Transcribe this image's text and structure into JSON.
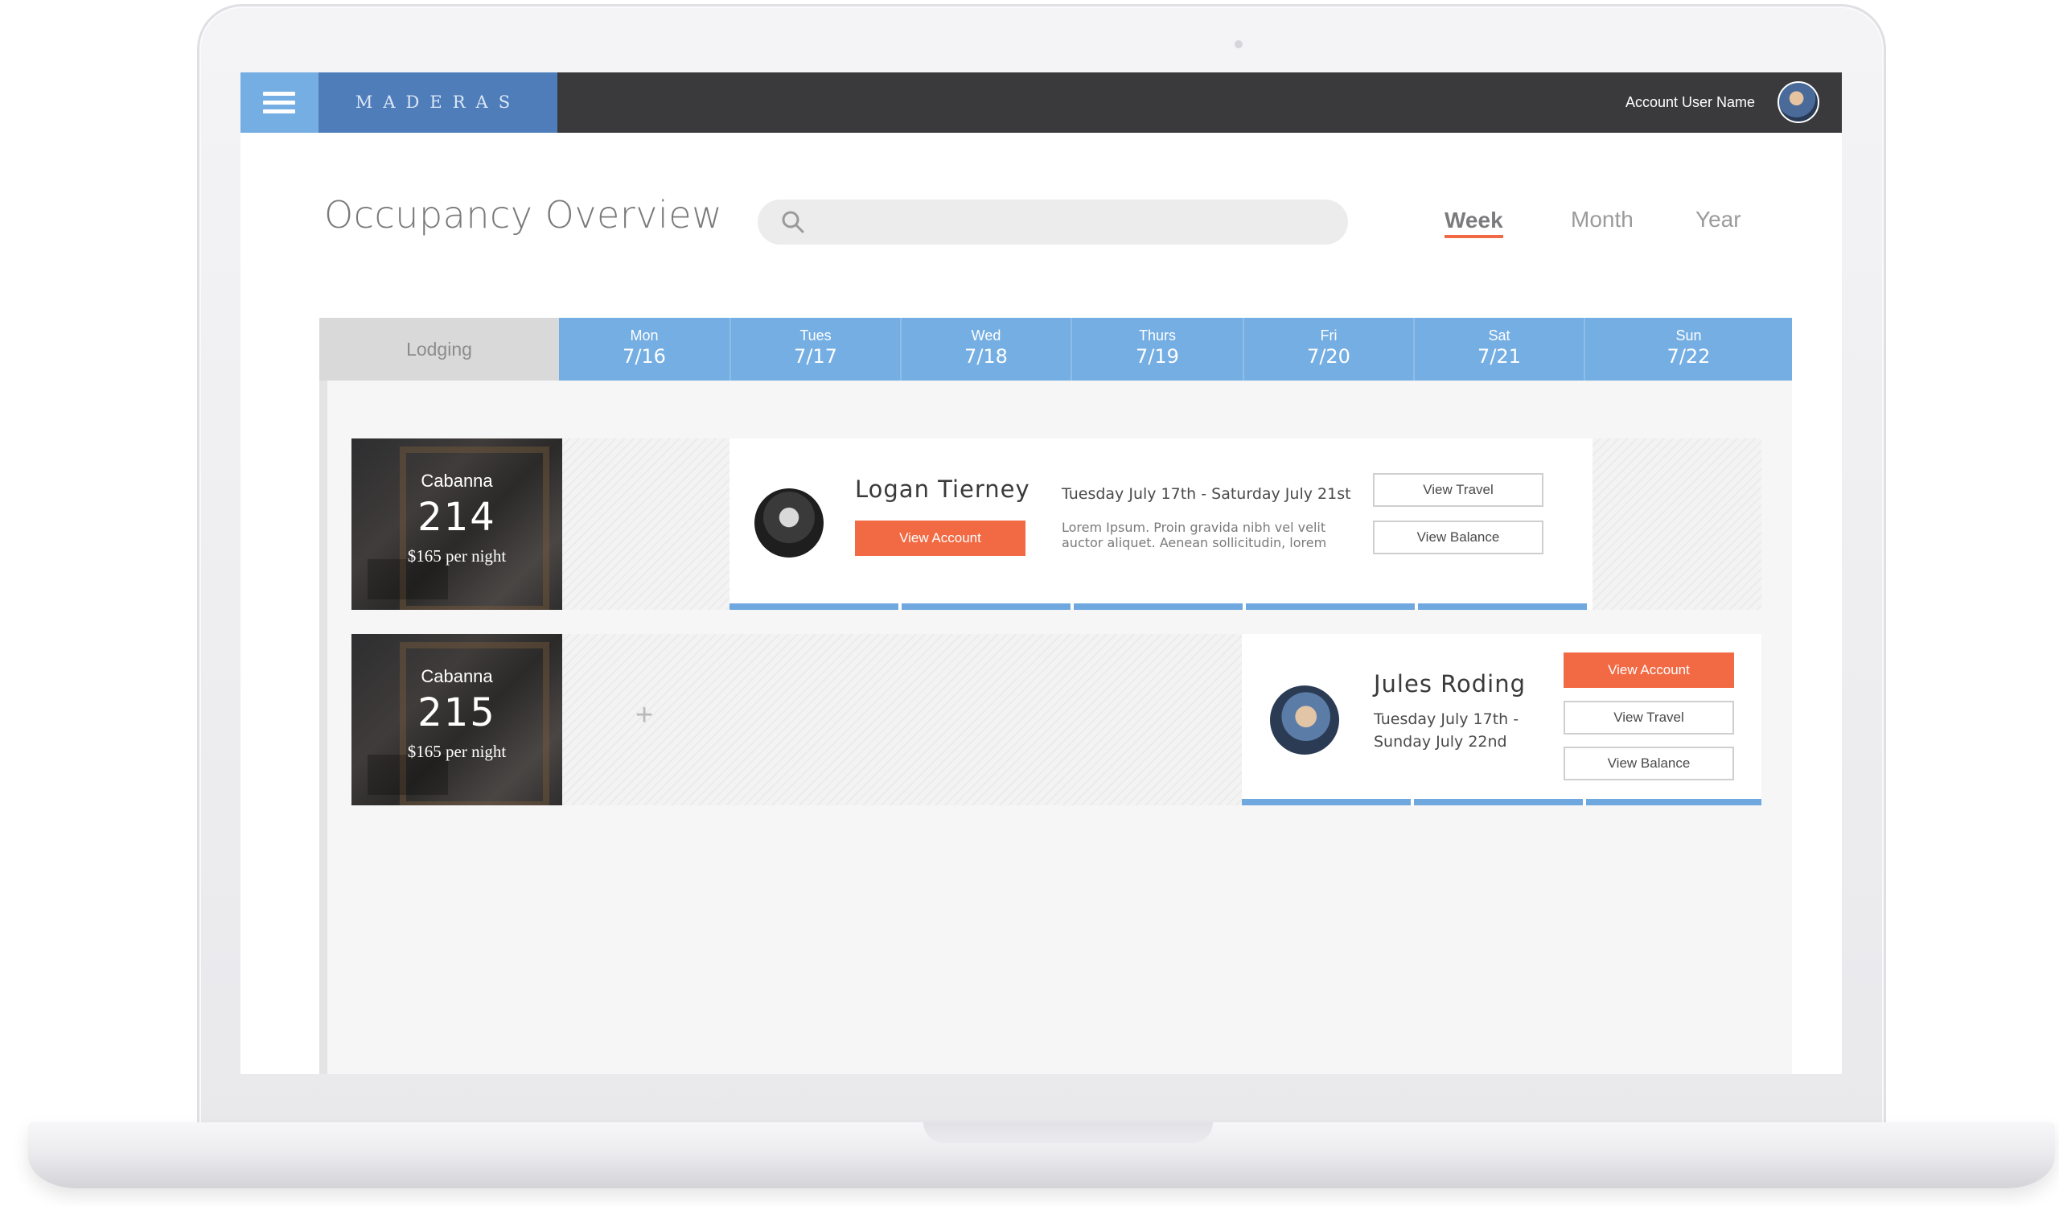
{
  "app": {
    "brand": "MADERAS",
    "account_name": "Account User Name"
  },
  "page": {
    "title": "Occupancy Overview"
  },
  "search": {
    "placeholder": ""
  },
  "view_tabs": [
    {
      "label": "Week",
      "active": true
    },
    {
      "label": "Month",
      "active": false
    },
    {
      "label": "Year",
      "active": false
    }
  ],
  "calendar": {
    "lodging_label": "Lodging",
    "days": [
      {
        "name": "Mon",
        "date": "7/16"
      },
      {
        "name": "Tues",
        "date": "7/17"
      },
      {
        "name": "Wed",
        "date": "7/18"
      },
      {
        "name": "Thurs",
        "date": "7/19"
      },
      {
        "name": "Fri",
        "date": "7/20"
      },
      {
        "name": "Sat",
        "date": "7/21"
      },
      {
        "name": "Sun",
        "date": "7/22"
      }
    ]
  },
  "rooms": [
    {
      "type": "Cabanna",
      "number": "214",
      "price": "$165 per night",
      "booking": {
        "guest": "Logan Tierney",
        "dates": "Tuesday July 17th - Saturday July 21st",
        "note": "Lorem Ipsum. Proin gravida nibh vel velit auctor aliquet. Aenean sollicitudin, lorem",
        "view_account": "View Account",
        "view_travel": "View Travel",
        "view_balance": "View Balance"
      }
    },
    {
      "type": "Cabanna",
      "number": "215",
      "price": "$165 per night",
      "add_label": "+",
      "booking": {
        "guest": "Jules Roding",
        "dates_line1": "Tuesday July 17th -",
        "dates_line2": "Sunday July 22nd",
        "view_account": "View Account",
        "view_travel": "View Travel",
        "view_balance": "View Balance"
      }
    }
  ],
  "colors": {
    "accent_blue": "#74aee3",
    "brand_blue": "#4f7dba",
    "accent_orange": "#f26a43",
    "topbar": "#3a3a3c"
  }
}
